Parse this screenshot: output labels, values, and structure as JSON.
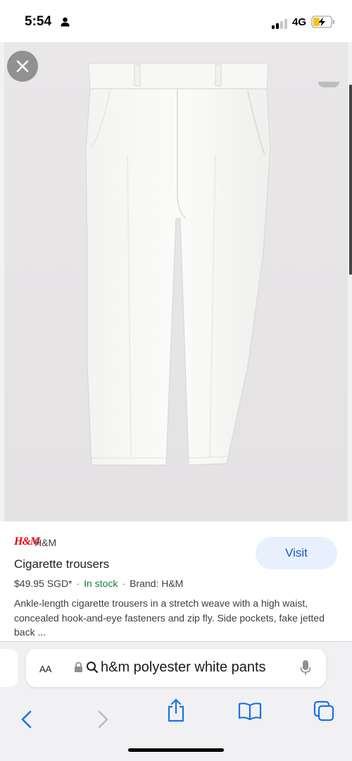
{
  "status_bar": {
    "time": "5:54",
    "network": "4G",
    "icons": [
      "person-icon",
      "signal-icon",
      "battery-charging-icon"
    ]
  },
  "image_viewer": {
    "close_icon": "close-icon",
    "image_subject": "white cigarette trousers"
  },
  "product": {
    "brand_logo": "H&M",
    "brand_name": "H&M",
    "visit_label": "Visit",
    "title": "Cigarette trousers",
    "price": "$49.95 SGD*",
    "separator": "·",
    "stock": "In stock",
    "brand": "Brand: H&M",
    "description": "Ankle-length cigarette trousers in a stretch weave with a high waist, concealed hook-and-eye fasteners and zip fly. Side pockets, fake jetted back ..."
  },
  "browser": {
    "aa_label": "AA",
    "address": "h&m polyester white pants",
    "nav_icons": [
      "back-icon",
      "forward-icon",
      "share-icon",
      "bookmarks-icon",
      "tabs-icon"
    ]
  },
  "colors": {
    "accent_blue": "#1a56c6",
    "visit_bg": "#e8f0fe",
    "stock_green": "#188038",
    "brand_red": "#e50010"
  }
}
